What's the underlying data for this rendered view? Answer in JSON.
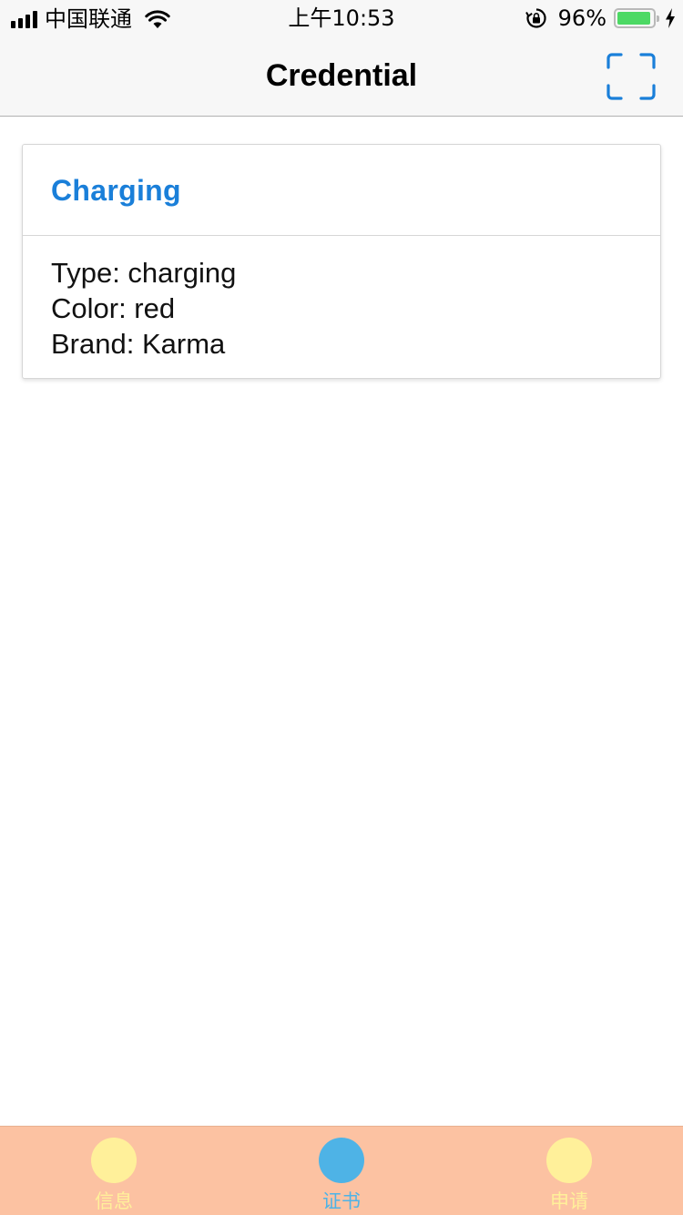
{
  "status_bar": {
    "carrier": "中国联通",
    "time": "上午10:53",
    "battery_percent": "96%",
    "battery_level": 0.96,
    "icons": [
      "signal-icon",
      "wifi-icon",
      "rotation-lock-icon",
      "battery-icon",
      "charging-bolt-icon"
    ]
  },
  "nav": {
    "title": "Credential",
    "scan_icon": "scan-frame-icon",
    "accent_color": "#1a7fd9"
  },
  "credential": {
    "title": "Charging",
    "details": [
      "Type: charging",
      "Color: red",
      "Brand: Karma"
    ]
  },
  "tab_bar": {
    "background": "#fcc2a2",
    "tabs": [
      {
        "label": "信息",
        "color": "#fff09a",
        "active": false
      },
      {
        "label": "证书",
        "color": "#4eb3e6",
        "active": true
      },
      {
        "label": "申请",
        "color": "#fff09a",
        "active": false
      }
    ]
  }
}
